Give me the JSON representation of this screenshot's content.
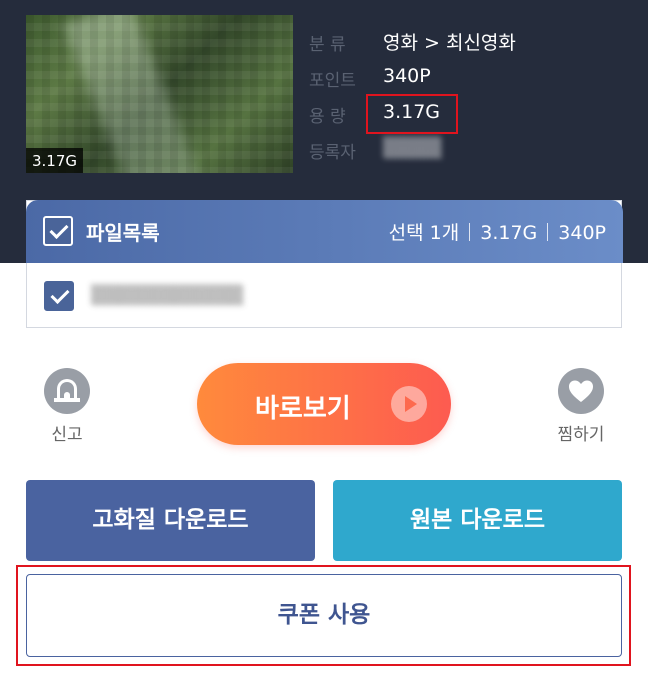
{
  "thumbnail": {
    "size_badge": "3.17G"
  },
  "info": {
    "category": {
      "label": "분  류",
      "value": "영화 > 최신영화"
    },
    "points": {
      "label": "포인트",
      "value": "340P"
    },
    "size": {
      "label": "용  량",
      "value": "3.17G"
    },
    "uploader": {
      "label": "등록자",
      "value": "▒▒▒▒"
    }
  },
  "file_list": {
    "title": "파일목록",
    "selection": "선택 1개",
    "total_size": "3.17G",
    "total_points": "340P",
    "files": [
      {
        "name": "▒▒▒▒▒▒▒▒▒▒▒"
      }
    ]
  },
  "actions": {
    "report_label": "신고",
    "play_label": "바로보기",
    "wish_label": "찜하기"
  },
  "downloads": {
    "hq_label": "고화질 다운로드",
    "original_label": "원본 다운로드"
  },
  "coupon": {
    "label": "쿠폰 사용"
  },
  "colors": {
    "header_bg": "#252c3c",
    "play_gradient_start": "#ff8a3c",
    "play_gradient_end": "#fd5b50",
    "hq_button": "#4a63a0",
    "original_button": "#2fa8cd",
    "highlight": "#e0141e"
  }
}
